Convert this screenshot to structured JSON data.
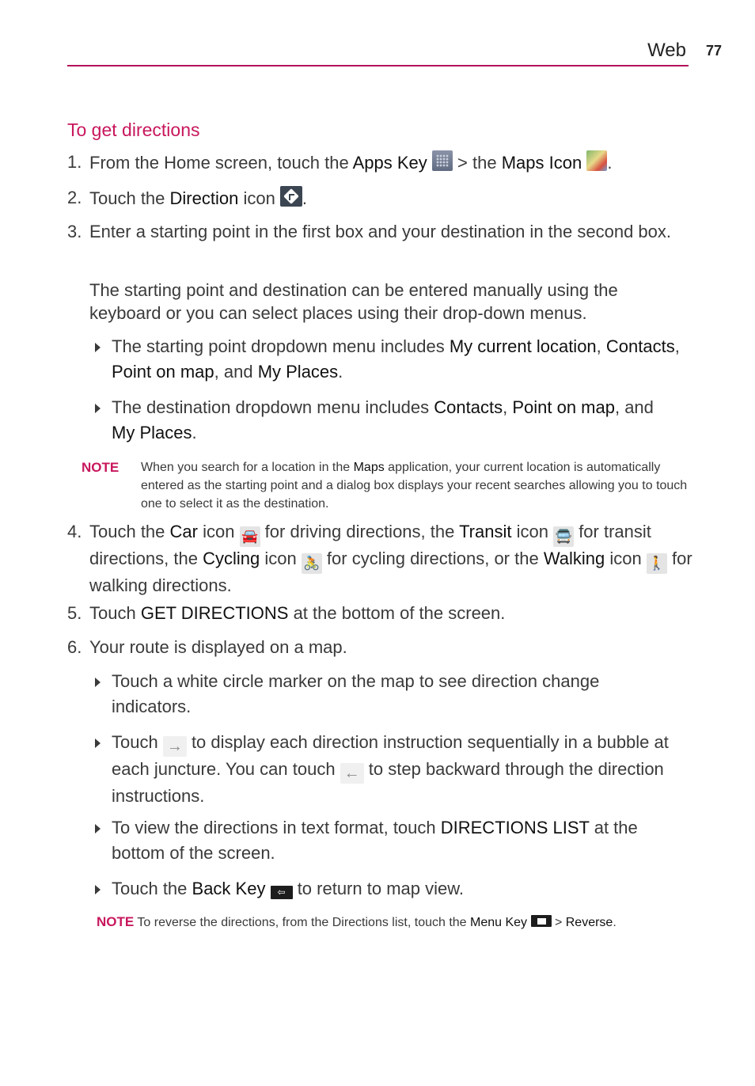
{
  "header": {
    "section": "Web",
    "page_number": "77",
    "accent_color": "#b5135a"
  },
  "title": "To get directions",
  "steps": {
    "s1": {
      "num": "1.",
      "t1": "From the Home screen, touch the ",
      "b1": "Apps Key",
      "t2": " > the ",
      "b2": "Maps Icon",
      "t3": ".",
      "icon1": "apps-key-icon",
      "icon2": "maps-icon"
    },
    "s2": {
      "num": "2.",
      "t1": "Touch the ",
      "b1": "Direction",
      "t2": " icon ",
      "t3": ".",
      "icon1": "direction-icon"
    },
    "s3": {
      "num": "3.",
      "text": "Enter a starting point in the first box and your destination in the second box.",
      "para": "The starting point and destination can be entered manually using the keyboard or you can select places using their drop-down menus.",
      "bullet1": {
        "t1": "The starting point dropdown menu includes ",
        "b1": "My current location",
        "t2": ", ",
        "b2": "Contacts",
        "t3": ", ",
        "b3": "Point on map",
        "t4": ", and ",
        "b4": "My Places",
        "t5": "."
      },
      "bullet2": {
        "t1": "The destination dropdown menu includes ",
        "b1": "Contacts",
        "t2": ", ",
        "b2": "Point on map",
        "t3": ", and ",
        "b3": "My Places",
        "t4": "."
      }
    },
    "note1": {
      "label": "NOTE",
      "t1": "When you search for a location in the ",
      "b1": "Maps",
      "t2": " application, your current location is automatically entered as the starting point and a dialog box displays your recent searches allowing you to touch one to select it as the destination."
    },
    "s4": {
      "num": "4.",
      "t1": "Touch the ",
      "b1": "Car",
      "t2": " icon ",
      "t3": " for driving directions, the ",
      "b2": "Transit",
      "t4": " icon ",
      "t5": " for transit directions, the ",
      "b3": "Cycling",
      "t6": " icon ",
      "t7": " for cycling directions, or the ",
      "b4": "Walking",
      "t8": " icon ",
      "t9": " for walking directions.",
      "car_glyph": "🚘",
      "transit_glyph": "🚍",
      "cycling_glyph": "🚴",
      "walking_glyph": "🚶"
    },
    "s5": {
      "num": "5.",
      "t1": "Touch ",
      "b1": "GET DIRECTIONS",
      "t2": " at the bottom of the screen."
    },
    "s6": {
      "num": "6.",
      "text": "Your route is displayed on a map.",
      "bullet1": "Touch a white circle marker on the map to see direction change indicators.",
      "bullet2": {
        "t1": "Touch ",
        "t2": " to display each direction instruction sequentially in a bubble at each juncture. You can touch ",
        "t3": " to step backward through the direction instructions.",
        "forward_glyph": "→",
        "back_glyph": "←"
      },
      "bullet3": {
        "t1": "To view the directions in text format, touch ",
        "b1": "DIRECTIONS LIST",
        "t2": " at the bottom of the screen."
      },
      "bullet4": {
        "t1": "Touch the ",
        "b1": "Back Key",
        "t2": " to return to map view.",
        "back_key_glyph": "⇦"
      }
    },
    "note2": {
      "label": "NOTE",
      "t1": " To reverse the directions, from the Directions list, touch the ",
      "b1": "Menu Key",
      "t2": " > ",
      "b2": "Reverse",
      "t3": "."
    }
  }
}
